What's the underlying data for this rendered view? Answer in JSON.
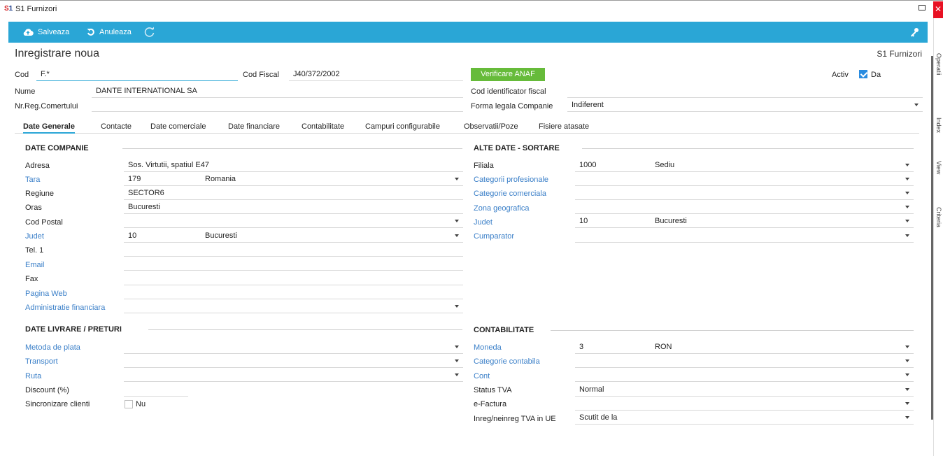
{
  "window": {
    "title": "S1 Furnizori",
    "logo": "S1"
  },
  "toolbar": {
    "save": "Salveaza",
    "cancel": "Anuleaza"
  },
  "heading": {
    "title": "Inregistrare noua",
    "module": "S1 Furnizori"
  },
  "right_strip": [
    "Operatii",
    "Index",
    "View",
    "Criteria"
  ],
  "header": {
    "cod_label": "Cod",
    "cod_value": "F.*",
    "codfiscal_label": "Cod Fiscal",
    "codfiscal_value": "J40/372/2002",
    "anaf_button": "Verificare ANAF",
    "activ_label": "Activ",
    "activ_value": "Da",
    "nume_label": "Nume",
    "nume_value": "DANTE INTERNATIONAL SA",
    "codid_label": "Cod identificator fiscal",
    "codid_value": "",
    "nrreg_label": "Nr.Reg.Comertului",
    "nrreg_value": "",
    "forma_label": "Forma legala Companie",
    "forma_value": "Indiferent"
  },
  "tabs": [
    "Date Generale",
    "Contacte",
    "Date comerciale",
    "Date financiare",
    "Contabilitate",
    "Campuri configurabile",
    "Observatii/Poze",
    "Fisiere atasate"
  ],
  "date_companie": {
    "title": "DATE COMPANIE",
    "adresa_label": "Adresa",
    "adresa_value": "Sos. Virtutii, spatiul E47",
    "tara_label": "Tara",
    "tara_code": "179",
    "tara_name": "Romania",
    "regiune_label": "Regiune",
    "regiune_value": "SECTOR6",
    "oras_label": "Oras",
    "oras_value": "Bucuresti",
    "codpostal_label": "Cod Postal",
    "codpostal_value": "",
    "judet_label": "Judet",
    "judet_code": "10",
    "judet_name": "Bucuresti",
    "tel_label": "Tel. 1",
    "tel_value": "",
    "email_label": "Email",
    "email_value": "",
    "fax_label": "Fax",
    "fax_value": "",
    "web_label": "Pagina Web",
    "web_value": "",
    "adminfin_label": "Administratie financiara",
    "adminfin_value": ""
  },
  "alte_date": {
    "title": "ALTE DATE - SORTARE",
    "filiala_label": "Filiala",
    "filiala_code": "1000",
    "filiala_name": "Sediu",
    "catprof_label": "Categorii profesionale",
    "catcom_label": "Categorie comerciala",
    "zona_label": "Zona geografica",
    "judet_label": "Judet",
    "judet_code": "10",
    "judet_name": "Bucuresti",
    "cumparator_label": "Cumparator"
  },
  "livrare": {
    "title": "DATE LIVRARE / PRETURI",
    "metoda_label": "Metoda de plata",
    "transport_label": "Transport",
    "ruta_label": "Ruta",
    "discount_label": "Discount (%)",
    "discount_value": "",
    "sincro_label": "Sincronizare clienti",
    "sincro_value": "Nu"
  },
  "contabilitate": {
    "title": "CONTABILITATE",
    "moneda_label": "Moneda",
    "moneda_code": "3",
    "moneda_name": "RON",
    "catcont_label": "Categorie contabila",
    "cont_label": "Cont",
    "statustva_label": "Status TVA",
    "statustva_value": "Normal",
    "efactura_label": "e-Factura",
    "efactura_value": "",
    "inreg_label": "Inreg/neinreg TVA in UE",
    "inreg_value": "Scutit de la"
  },
  "colors": {
    "accent": "#2aa6d6",
    "link": "#3a7fc8",
    "anaf": "#66bb3a"
  }
}
